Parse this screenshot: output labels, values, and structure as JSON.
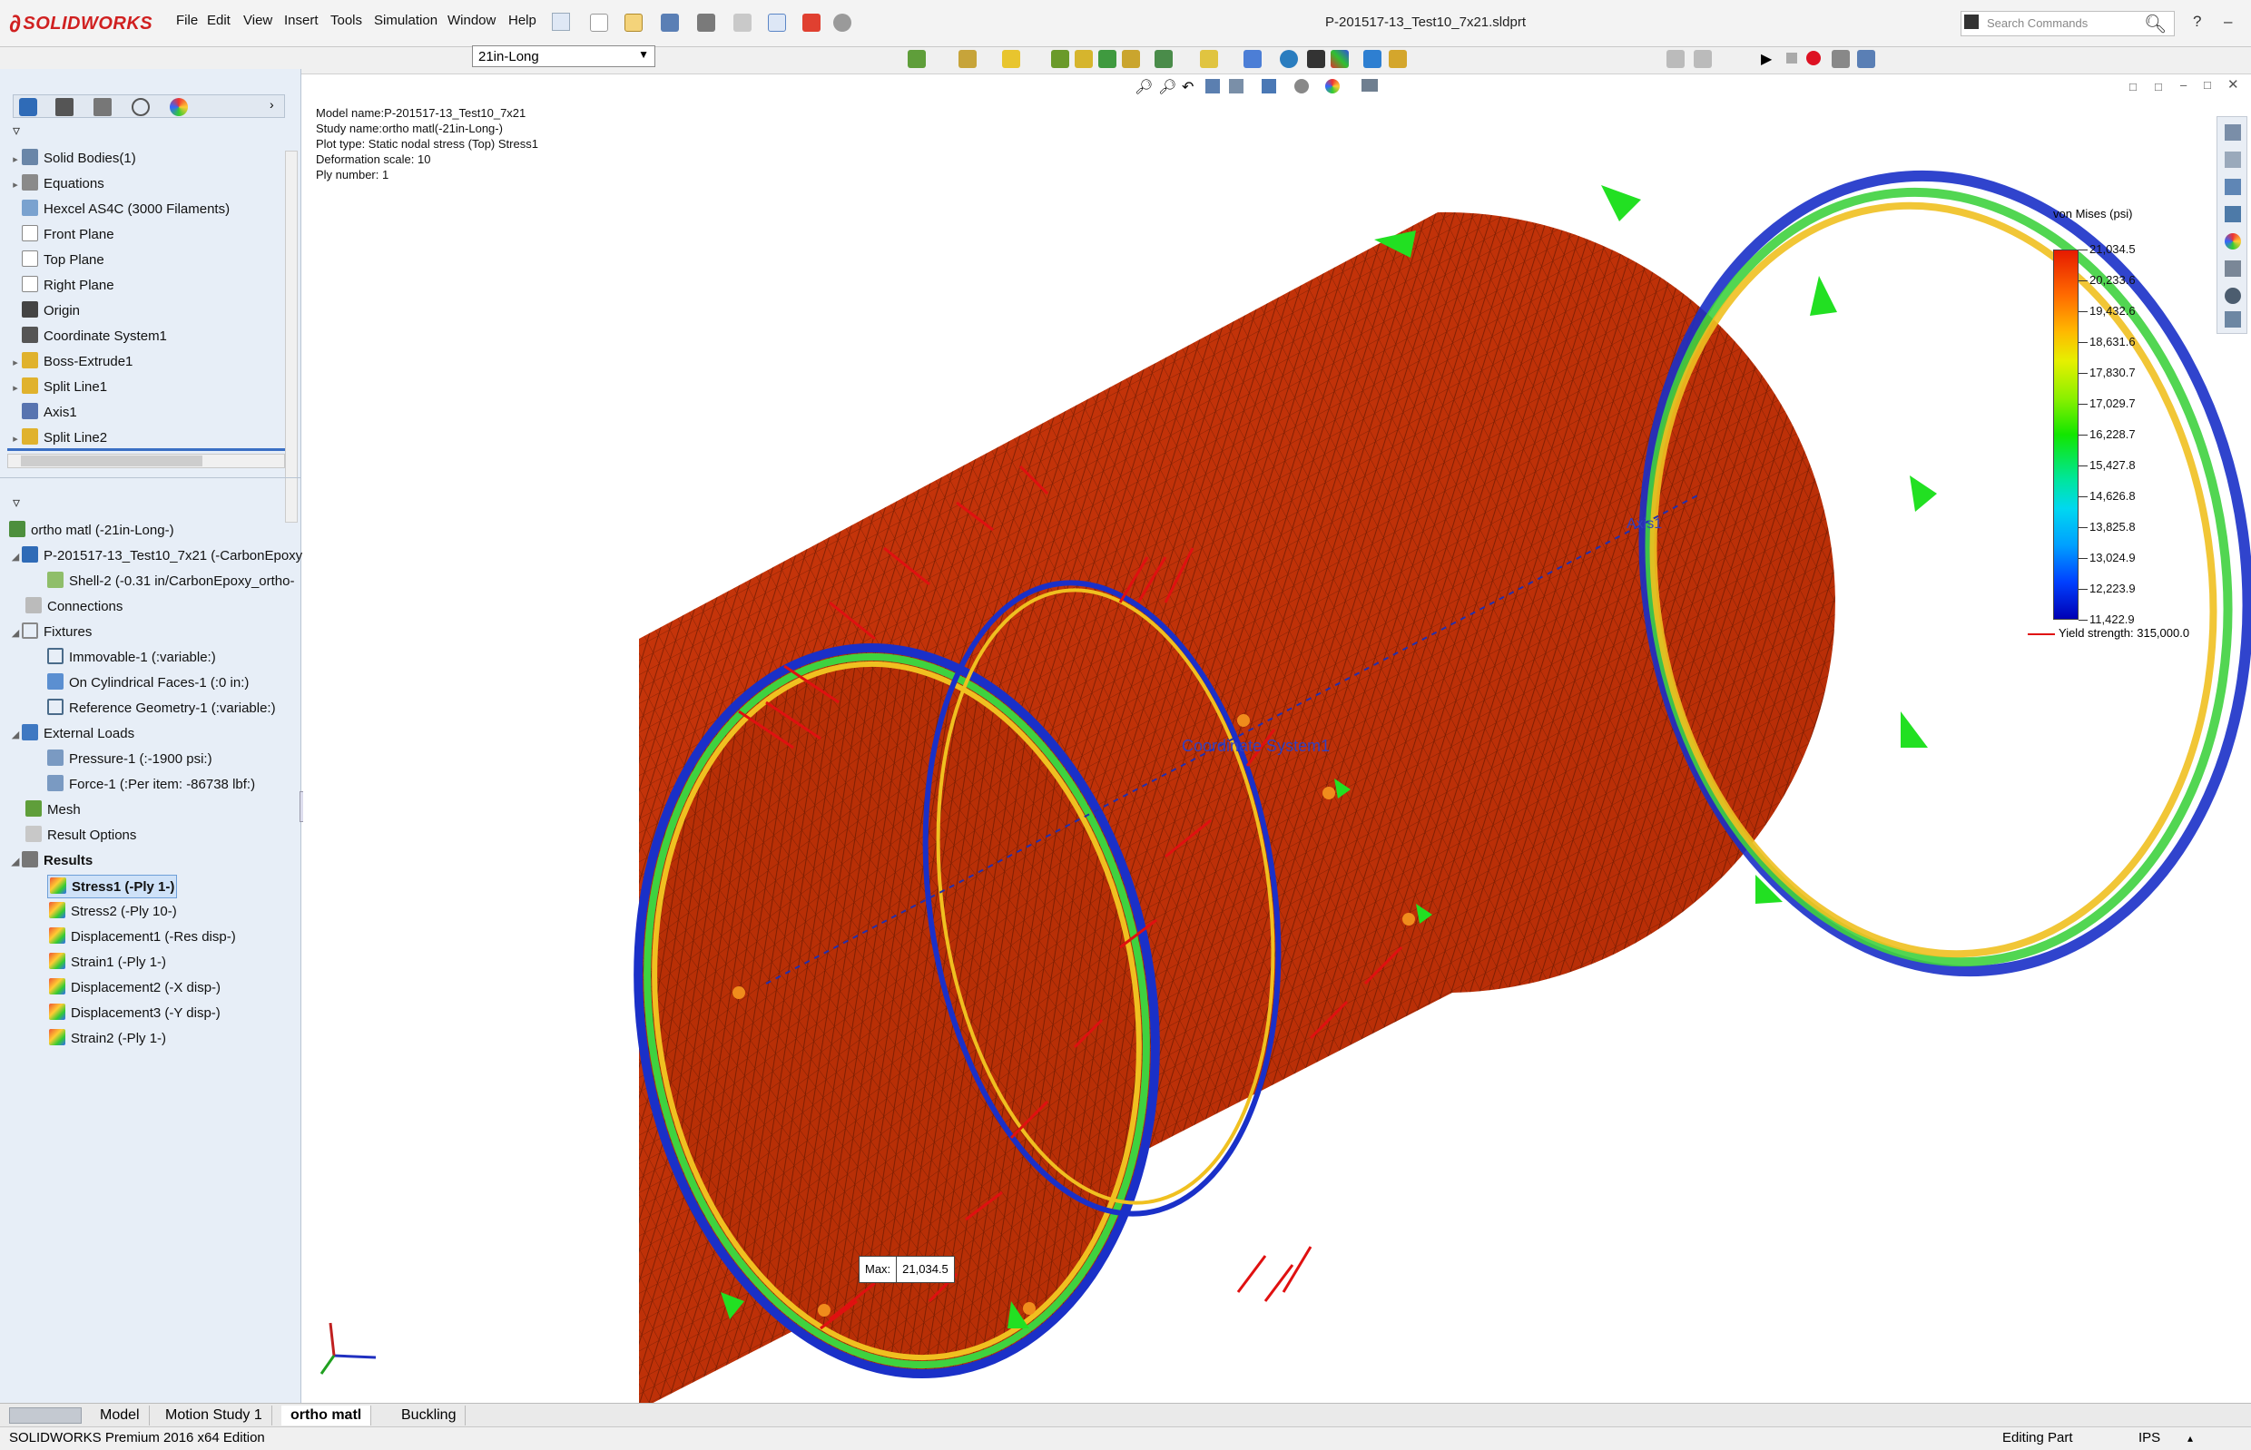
{
  "app": {
    "logo": "SOLIDWORKS",
    "file_title": "P-201517-13_Test10_7x21.sldprt",
    "search_placeholder": "Search Commands",
    "help_symbol": "?"
  },
  "menu": [
    "File",
    "Edit",
    "View",
    "Insert",
    "Tools",
    "Simulation",
    "Window",
    "Help"
  ],
  "config_select": {
    "value": "21in-Long"
  },
  "feature_tree": [
    {
      "label": "Solid Bodies(1)",
      "icon": "folder-icon",
      "expander": true
    },
    {
      "label": "Equations",
      "icon": "equation-icon",
      "expander": true
    },
    {
      "label": "Hexcel AS4C (3000 Filaments)",
      "icon": "material-icon",
      "expander": false
    },
    {
      "label": "Front Plane",
      "icon": "plane-icon",
      "expander": false
    },
    {
      "label": "Top Plane",
      "icon": "plane-icon",
      "expander": false
    },
    {
      "label": "Right Plane",
      "icon": "plane-icon",
      "expander": false
    },
    {
      "label": "Origin",
      "icon": "origin-icon",
      "expander": false
    },
    {
      "label": "Coordinate System1",
      "icon": "coordinate-icon",
      "expander": false
    },
    {
      "label": "Boss-Extrude1",
      "icon": "extrude-icon",
      "expander": true
    },
    {
      "label": "Split Line1",
      "icon": "split-line-icon",
      "expander": true
    },
    {
      "label": "Axis1",
      "icon": "axis-icon",
      "expander": false
    },
    {
      "label": "Split Line2",
      "icon": "split-line-icon",
      "expander": true
    }
  ],
  "sim_tree": {
    "study": "ortho matl (-21in-Long-)",
    "part": "P-201517-13_Test10_7x21 (-CarbonEpoxy",
    "shell": "Shell-2 (-0.31 in/CarbonEpoxy_ortho-",
    "connections": "Connections",
    "fixtures": "Fixtures",
    "fixture_items": [
      "Immovable-1 (:variable:)",
      "On Cylindrical Faces-1 (:0 in:)",
      "Reference Geometry-1 (:variable:)"
    ],
    "external_loads": "External Loads",
    "load_items": [
      "Pressure-1 (:-1900 psi:)",
      "Force-1 (:Per item: -86738 lbf:)"
    ],
    "mesh": "Mesh",
    "result_options": "Result Options",
    "results": "Results",
    "result_items": [
      "Stress1 (-Ply 1-)",
      "Stress2 (-Ply 10-)",
      "Displacement1 (-Res disp-)",
      "Strain1 (-Ply 1-)",
      "Displacement2 (-X disp-)",
      "Displacement3 (-Y disp-)",
      "Strain2 (-Ply 1-)"
    ]
  },
  "plot_info": [
    "Model name:P-201517-13_Test10_7x21",
    "Study name:ortho matl(-21in-Long-)",
    "Plot type: Static nodal stress (Top) Stress1",
    "Deformation scale: 10",
    "Ply number: 1"
  ],
  "legend": {
    "title": "von Mises (psi)",
    "ticks": [
      "21,034.5",
      "20,233.6",
      "19,432.6",
      "18,631.6",
      "17,830.7",
      "17,029.7",
      "16,228.7",
      "15,427.8",
      "14,626.8",
      "13,825.8",
      "13,024.9",
      "12,223.9",
      "11,422.9"
    ],
    "yield": "Yield strength: 315,000.0"
  },
  "probe": {
    "label": "Max:",
    "value": "21,034.5"
  },
  "viewport_labels": {
    "axis": "Axis1",
    "coord": "Coordinate System1"
  },
  "tabs": [
    "Model",
    "Motion Study 1",
    "ortho matl",
    "Buckling"
  ],
  "status": {
    "edition": "SOLIDWORKS Premium 2016 x64 Edition",
    "mode": "Editing Part",
    "units": "IPS"
  }
}
